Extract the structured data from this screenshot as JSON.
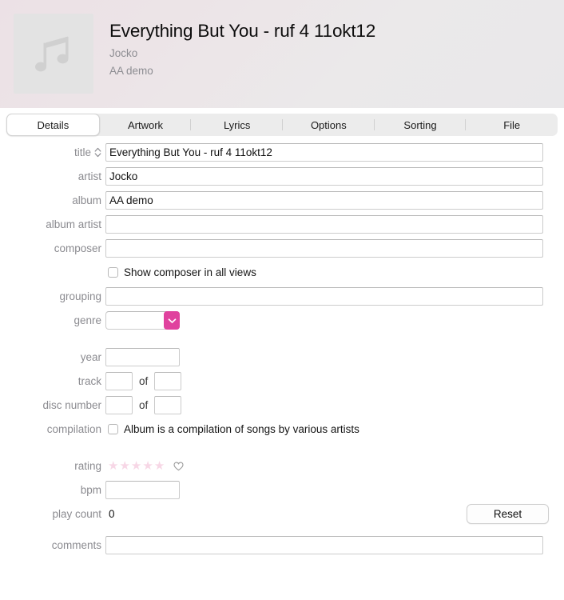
{
  "header": {
    "artwork_icon": "music-note-icon",
    "title": "Everything But You - ruf 4 11okt12",
    "artist": "Jocko",
    "album": "AA demo"
  },
  "tabs": [
    {
      "label": "Details",
      "selected": true
    },
    {
      "label": "Artwork",
      "selected": false
    },
    {
      "label": "Lyrics",
      "selected": false
    },
    {
      "label": "Options",
      "selected": false
    },
    {
      "label": "Sorting",
      "selected": false
    },
    {
      "label": "File",
      "selected": false
    }
  ],
  "form": {
    "title": {
      "label": "title",
      "value": "Everything But You - ruf 4 11okt12",
      "sort_icon": "chevron-up-down-icon"
    },
    "artist": {
      "label": "artist",
      "value": "Jocko"
    },
    "album": {
      "label": "album",
      "value": "AA demo"
    },
    "album_artist": {
      "label": "album artist",
      "value": ""
    },
    "composer": {
      "label": "composer",
      "value": ""
    },
    "show_composer": {
      "text": "Show composer in all views",
      "checked": false
    },
    "grouping": {
      "label": "grouping",
      "value": ""
    },
    "genre": {
      "label": "genre",
      "value": "",
      "dropdown_icon": "chevron-down-icon",
      "accent": "#e0429e"
    },
    "year": {
      "label": "year",
      "value": ""
    },
    "track": {
      "label": "track",
      "value": "",
      "of_label": "of",
      "of_value": ""
    },
    "disc_number": {
      "label": "disc number",
      "value": "",
      "of_label": "of",
      "of_value": ""
    },
    "compilation": {
      "label": "compilation",
      "text": "Album is a compilation of songs by various artists",
      "checked": false
    },
    "rating": {
      "label": "rating",
      "stars": 5,
      "star_glyph": "★",
      "star_color": "#f7d7e6",
      "love_icon": "heart-outline-icon"
    },
    "bpm": {
      "label": "bpm",
      "value": ""
    },
    "play_count": {
      "label": "play count",
      "value": "0",
      "reset_label": "Reset"
    },
    "comments": {
      "label": "comments",
      "value": ""
    }
  }
}
